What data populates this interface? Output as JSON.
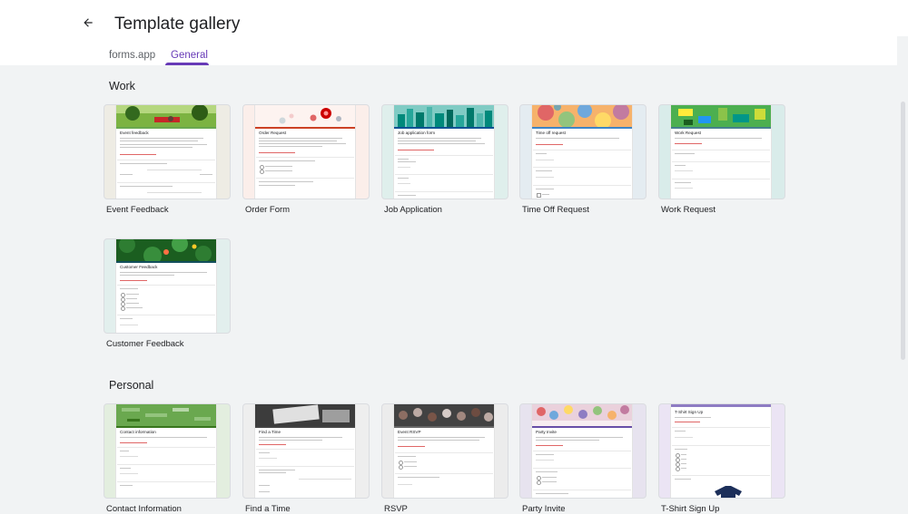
{
  "header": {
    "title": "Template gallery",
    "back_icon": "arrow-left-icon"
  },
  "tabs": [
    {
      "label": "forms.app",
      "active": false
    },
    {
      "label": "General",
      "active": true
    }
  ],
  "sections": {
    "work": {
      "title": "Work",
      "templates": [
        {
          "label": "Event Feedback",
          "form_title": "Event feedback",
          "bg": "#eeece4",
          "accent": "#6aa84f"
        },
        {
          "label": "Order Form",
          "form_title": "Order Request",
          "bg": "#fbeeea",
          "accent": "#cc4125"
        },
        {
          "label": "Job Application",
          "form_title": "Job application form",
          "bg": "#dfefec",
          "accent": "#0b5394"
        },
        {
          "label": "Time Off Request",
          "form_title": "Time off request",
          "bg": "#e4ecf1",
          "accent": "#3d85c6"
        },
        {
          "label": "Work Request",
          "form_title": "Work Request",
          "bg": "#d9ecea",
          "accent": "#45818e"
        },
        {
          "label": "Customer Feedback",
          "form_title": "Customer Feedback",
          "bg": "#e2efed",
          "accent": "#134f5c"
        }
      ]
    },
    "personal": {
      "title": "Personal",
      "templates": [
        {
          "label": "Contact Information",
          "form_title": "Contact information",
          "bg": "#e3eedf",
          "accent": "#38761d"
        },
        {
          "label": "Find a Time",
          "form_title": "Find a Time",
          "bg": "#eeeeee",
          "accent": "#434343"
        },
        {
          "label": "RSVP",
          "form_title": "Event RSVP",
          "bg": "#ececec",
          "accent": "#666666"
        },
        {
          "label": "Party Invite",
          "form_title": "Party Invite",
          "bg": "#e7e3ef",
          "accent": "#674ea7"
        },
        {
          "label": "T-Shirt Sign Up",
          "form_title": "T-Shirt Sign Up",
          "bg": "#ebe4f4",
          "accent": "#8e7cc3"
        }
      ]
    }
  }
}
